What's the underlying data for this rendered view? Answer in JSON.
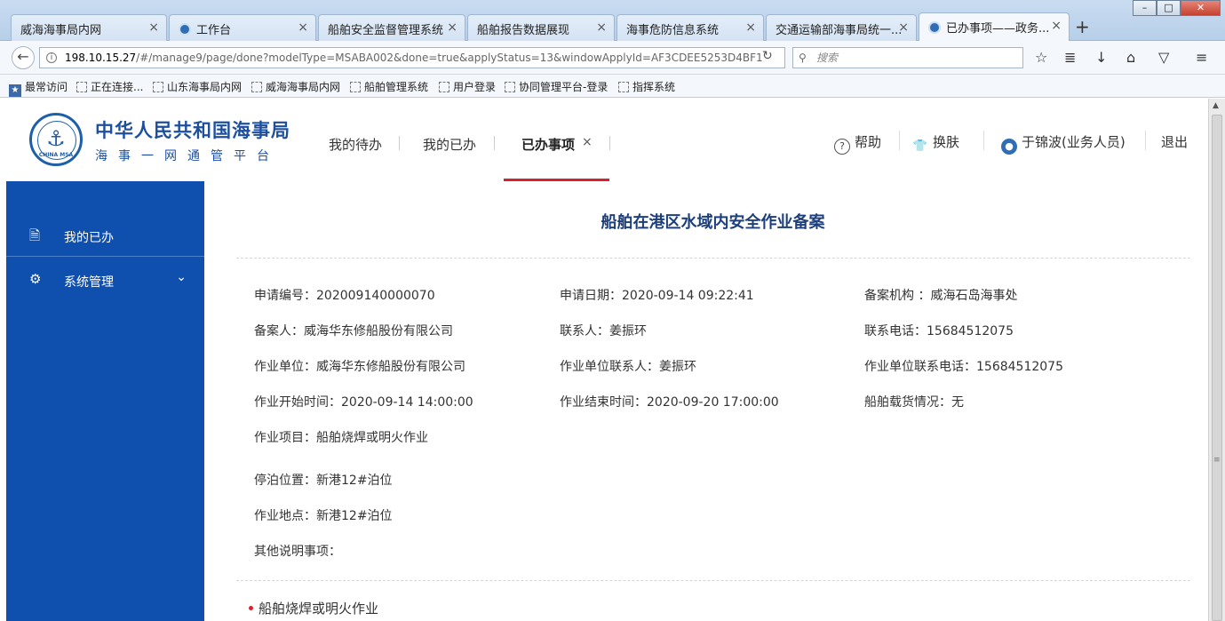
{
  "browser": {
    "tabs": [
      {
        "label": "威海海事局内网"
      },
      {
        "label": "工作台"
      },
      {
        "label": "船舶安全监督管理系统"
      },
      {
        "label": "船舶报告数据展现"
      },
      {
        "label": "海事危防信息系统"
      },
      {
        "label": "交通运输部海事局统一..."
      },
      {
        "label": "已办事项——政务..."
      }
    ],
    "url_host": "198.10.15.27",
    "url_path": "/#/manage9/page/done?modelType=MSABA002&done=true&applyStatus=13&windowApplyId=AF3CDEE5253D4BF1",
    "search_placeholder": "搜索",
    "bookmarks": [
      "最常访问",
      "正在连接...",
      "山东海事局内网",
      "威海海事局内网",
      "船舶管理系统",
      "用户登录",
      "协同管理平台-登录",
      "指挥系统"
    ]
  },
  "header": {
    "title": "中华人民共和国海事局",
    "subtitle": "海事一网通管平台",
    "logo_text": "CHINA MSA",
    "nav": {
      "todo": "我的待办",
      "done": "我的已办",
      "active": "已办事项"
    },
    "help": "帮助",
    "skin": "换肤",
    "user": "于锦波(业务人员)",
    "logout": "退出"
  },
  "sidebar": {
    "items": [
      {
        "label": "我的已办"
      },
      {
        "label": "系统管理"
      }
    ]
  },
  "form": {
    "title": "船舶在港区水域内安全作业备案",
    "fields": {
      "apply_no": "申请编号：202009140000070",
      "apply_date": "申请日期：2020-09-14 09:22:41",
      "org": "备案机构 ：威海石岛海事处",
      "filer": "备案人：威海华东修船股份有限公司",
      "contact": "联系人：姜振环",
      "phone": "联系电话：15684512075",
      "work_unit": "作业单位：威海华东修船股份有限公司",
      "work_contact": "作业单位联系人：姜振环",
      "work_phone": "作业单位联系电话：15684512075",
      "start_time": "作业开始时间：2020-09-14 14:00:00",
      "end_time": "作业结束时间：2020-09-20 17:00:00",
      "cargo": "船舶载货情况：无",
      "project": "作业项目：船舶烧焊或明火作业",
      "berth": "停泊位置：新港12#泊位",
      "location": "作业地点：新港12#泊位",
      "other": "其他说明事项："
    },
    "bullet": "船舶烧焊或明火作业"
  }
}
